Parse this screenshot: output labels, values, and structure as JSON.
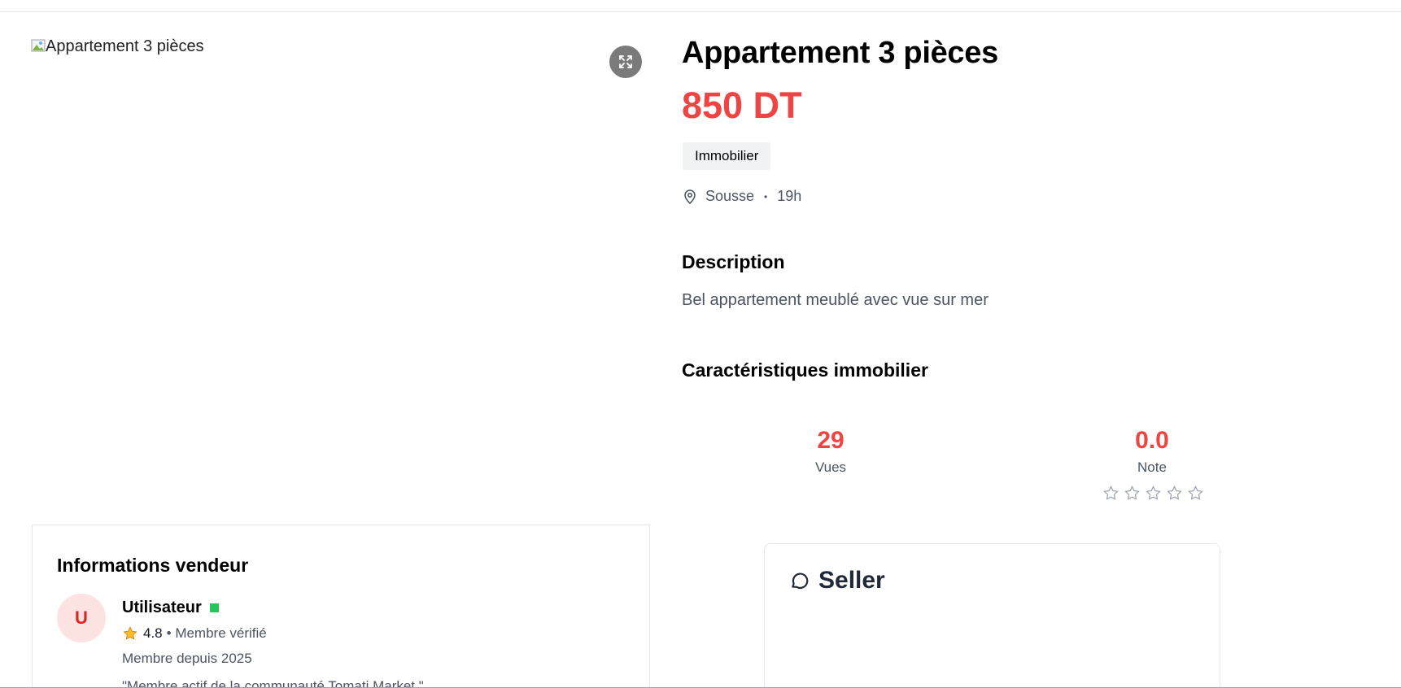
{
  "listing": {
    "image_alt": "Appartement 3 pièces",
    "title": "Appartement 3 pièces",
    "price": "850 DT",
    "category": "Immobilier",
    "location": "Sousse",
    "separator": "•",
    "posted": "19h",
    "description_heading": "Description",
    "description": "Bel appartement meublé avec vue sur mer",
    "features_heading": "Caractéristiques immobilier"
  },
  "stats": {
    "views_value": "29",
    "views_label": "Vues",
    "rating_value": "0.0",
    "rating_label": "Note",
    "stars_filled": 0,
    "stars_total": 5
  },
  "seller": {
    "heading": "Informations vendeur",
    "avatar_initial": "U",
    "name": "Utilisateur",
    "rating": "4.8",
    "rating_suffix": "• Membre vérifié",
    "member_since": "Membre depuis 2025",
    "bio": "\"Membre actif de la communauté Tomati Market.\""
  },
  "chat": {
    "title": "Seller"
  },
  "colors": {
    "accent": "#ef4444",
    "online": "#22c55e",
    "avatar_bg": "#fde2e2"
  },
  "icons": [
    "expand-icon",
    "location-pin-icon",
    "star-outline-icon",
    "star-filled-icon",
    "chat-bubble-icon",
    "broken-image-icon"
  ]
}
